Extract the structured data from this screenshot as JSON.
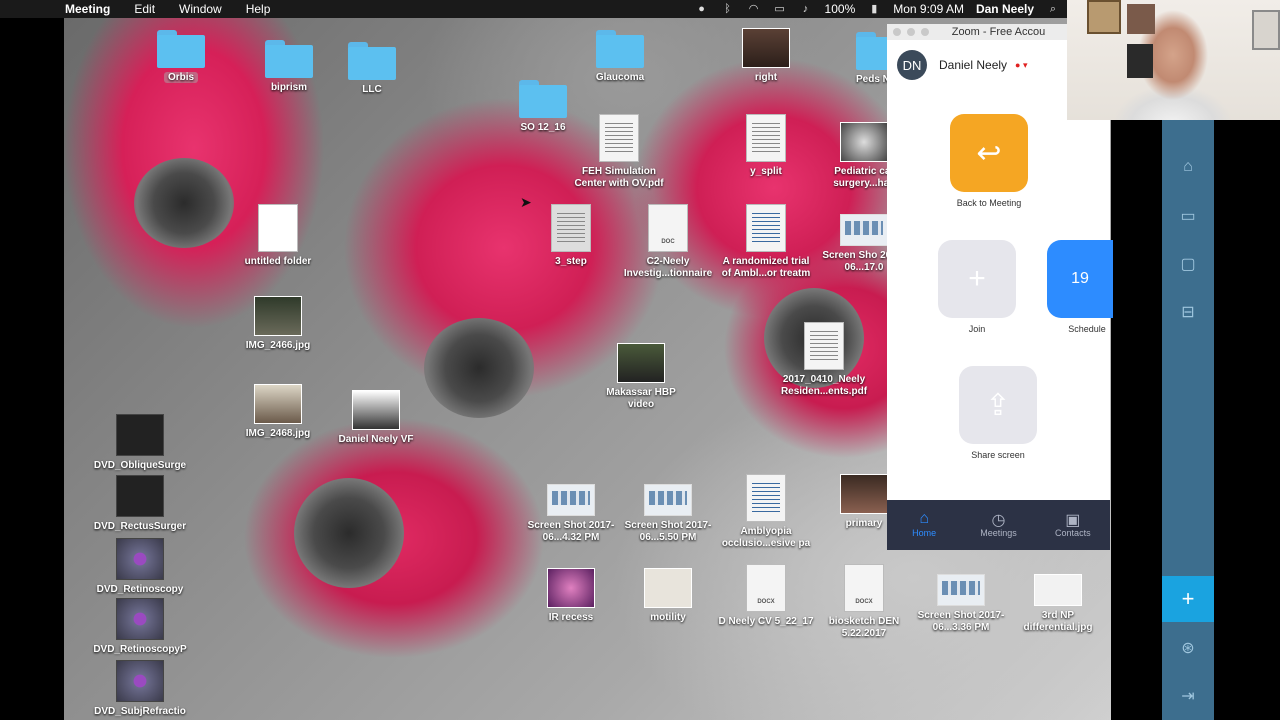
{
  "menubar": {
    "items": [
      "Meeting",
      "Edit",
      "Window",
      "Help"
    ],
    "battery": "100%",
    "clock": "Mon 9:09 AM",
    "user": "Dan Neely"
  },
  "desktop_icons": {
    "orbis": "Orbis",
    "biprism": "biprism",
    "llc": "LLC",
    "so": "SO 12_16",
    "glaucoma": "Glaucoma",
    "right": "right",
    "peds": "Peds N",
    "feh": "FEH Simulation Center with OV.pdf",
    "ysplit": "y_split",
    "pediatric": "Pediatric cat surgery...hak",
    "untitled": "untitled folder",
    "step3": "3_step",
    "c2": "C2-Neely Investig...tionnaire",
    "randomized": "A randomized trial of Ambl...or treatm",
    "screenshot1": "Screen Sho 2017-06...17.0",
    "img2466": "IMG_2466.jpg",
    "makassar": "Makassar HBP video",
    "neelyres": "2017_0410_Neely Residen...ents.pdf",
    "img2468": "IMG_2468.jpg",
    "danvf": "Daniel Neely VF",
    "dvd1": "DVD_ObliqueSurge",
    "dvd2": "DVD_RectusSurger",
    "dvd3": "DVD_Retinoscopy",
    "dvd4": "DVD_RetinoscopyP",
    "dvd5": "DVD_SubjRefractio",
    "screenshot2": "Screen Shot 2017-06...4.32 PM",
    "screenshot3": "Screen Shot 2017-06...5.50 PM",
    "amblyopia": "Amblyopia occlusio...esive pa",
    "primary": "primary",
    "irrecess": "IR recess",
    "motility": "motility",
    "cv": "D Neely CV 5_22_17",
    "biosketch": "biosketch DEN 5.22.2017",
    "screenshot4": "Screen Shot 2017-06...3.36 PM",
    "nprd": "3rd NP differential.jpg",
    "docx_badge": "DOCX",
    "doc_badge": "DOC"
  },
  "zoom": {
    "title": "Zoom - Free Accou",
    "initials": "DN",
    "user_name": "Daniel Neely",
    "back_label": "Back to Meeting",
    "join_label": "Join",
    "schedule_label": "Schedule",
    "schedule_day": "19",
    "share_label": "Share screen",
    "nav": [
      "Home",
      "Meetings",
      "Contacts"
    ]
  }
}
